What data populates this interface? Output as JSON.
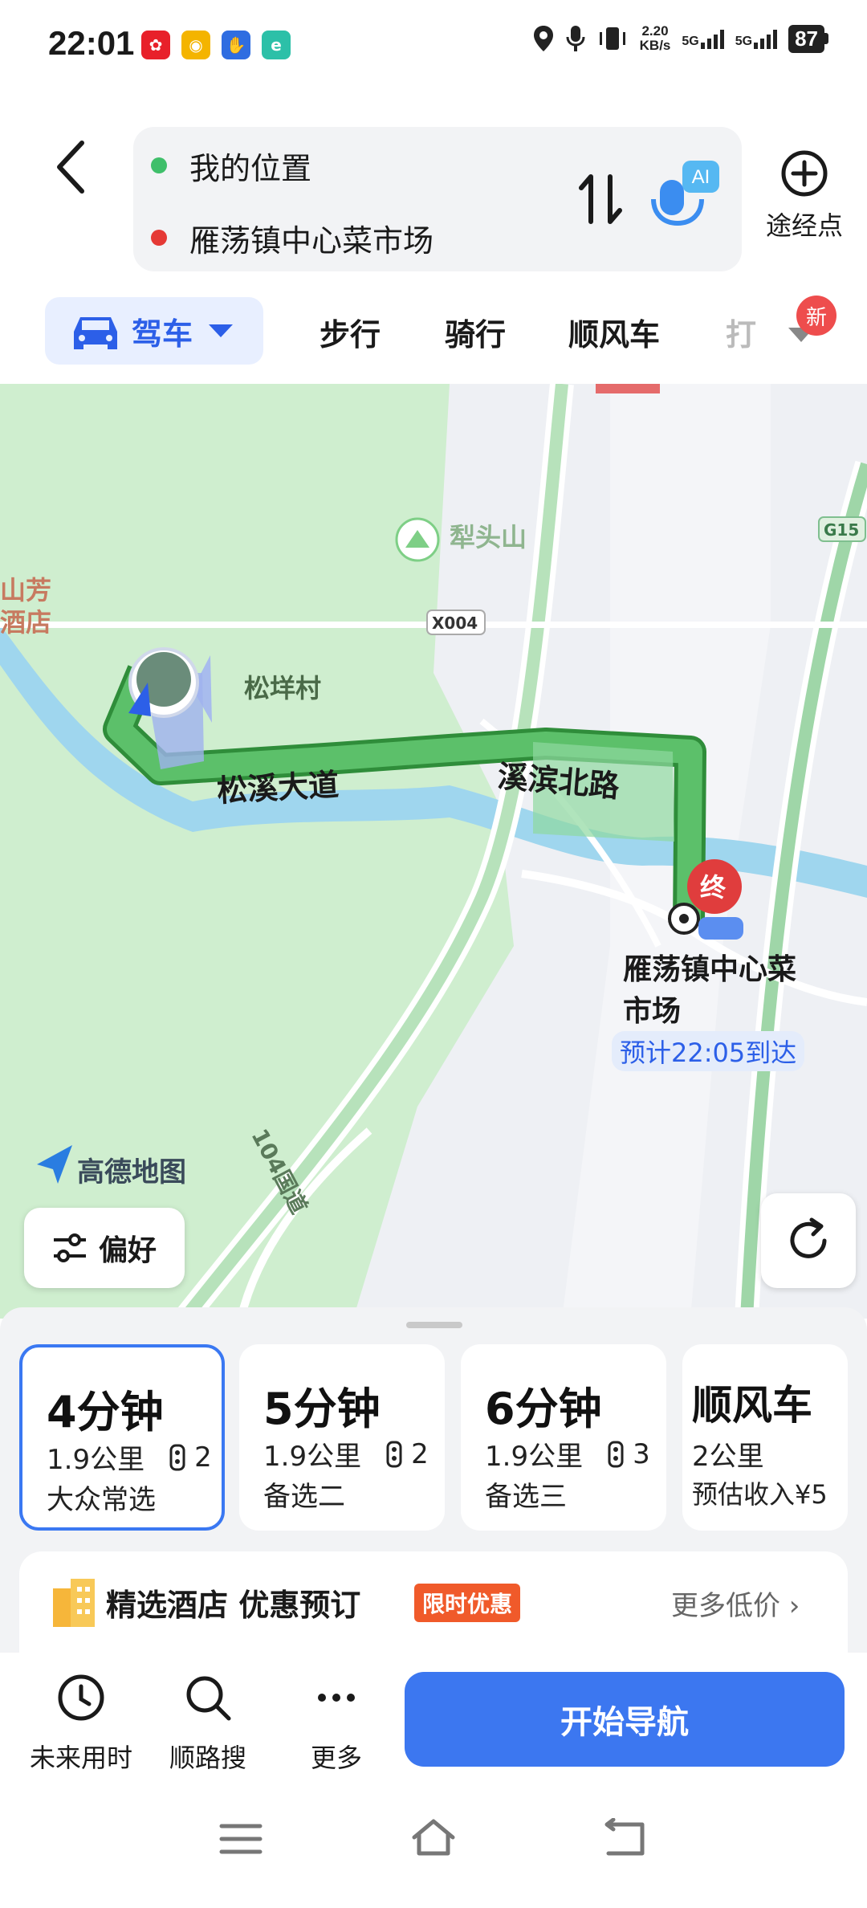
{
  "status_bar": {
    "time": "22:01",
    "net_speed_value": "2.20",
    "net_speed_unit": "KB/s",
    "sim1": "5G",
    "sim2": "5G",
    "battery": "87"
  },
  "route": {
    "origin": "我的位置",
    "destination": "雁荡镇中心菜市场",
    "ai_label": "AI",
    "waypoint_label": "途经点"
  },
  "modes": {
    "active": "驾车",
    "tabs": [
      "步行",
      "骑行",
      "顺风车",
      "打"
    ],
    "new_badge": "新"
  },
  "map": {
    "labels": {
      "lishan": "犁头山",
      "songyang": "松垟村",
      "road_songxi": "松溪大道",
      "road_xibin": "溪滨北路",
      "road_x004": "X004",
      "road_g15": "G15",
      "road_104": "104国道",
      "left_poi_1": "山芳",
      "left_poi_2": "酒店",
      "end_marker": "终",
      "destination_line1": "雁荡镇中心菜",
      "destination_line2": "市场",
      "eta": "预计22:05到达",
      "brand": "高德地图"
    },
    "preference_label": "偏好"
  },
  "route_options": [
    {
      "time": "4分钟",
      "distance": "1.9公里",
      "lights": "2",
      "tag": "大众常选"
    },
    {
      "time": "5分钟",
      "distance": "1.9公里",
      "lights": "2",
      "tag": "备选二"
    },
    {
      "time": "6分钟",
      "distance": "1.9公里",
      "lights": "3",
      "tag": "备选三"
    },
    {
      "time": "顺风车",
      "distance": "2公里",
      "tag": "预估收入¥5"
    }
  ],
  "hotel": {
    "title": "精选酒店 优惠预订",
    "badge": "限时优惠",
    "more": "更多低价"
  },
  "actions": {
    "future": "未来用时",
    "along": "顺路搜",
    "more": "更多",
    "start": "开始导航"
  },
  "colors": {
    "accent": "#3c77f0",
    "route_green": "#4cae4f",
    "map_green": "#cfeecf",
    "water": "#9fd6ee"
  }
}
